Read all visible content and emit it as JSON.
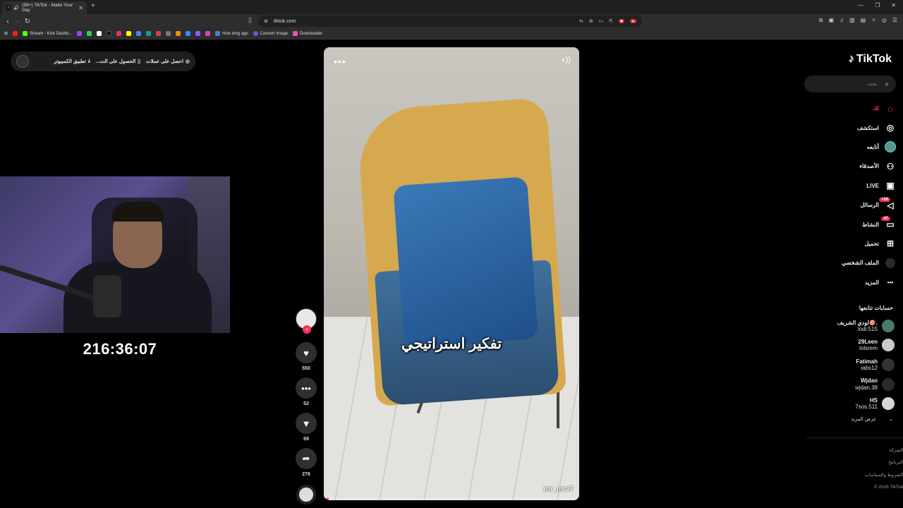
{
  "browser": {
    "tab_title": "(99+) TikTok - Make Your Day",
    "url": "tiktok.com",
    "bookmarks": [
      "Stream - Kick Dashb...",
      "How long ago",
      "Convert Image",
      "Downloader"
    ]
  },
  "top_bar": {
    "coins_label": "احصل على عملات",
    "get_app_label": "الحصول على الت...",
    "desktop_app_label": "تطبيق الكمبيوتر"
  },
  "stream": {
    "timer": "216:36:07"
  },
  "video": {
    "caption": "تفكير استراتيجي",
    "username": "mr_mrv7",
    "progress": 0.02
  },
  "actions": {
    "likes": "550",
    "comments": "52",
    "bookmarks": "69",
    "shares": "276"
  },
  "sidebar": {
    "logo": "TikTok",
    "search_placeholder": "بحث",
    "nav": [
      {
        "label": "لك",
        "icon": "home-icon",
        "active": true
      },
      {
        "label": "استكشف",
        "icon": "compass-icon"
      },
      {
        "label": "أتابعه",
        "icon": "following-avatar"
      },
      {
        "label": "الأصدقاء",
        "icon": "friends-icon"
      },
      {
        "label": "LIVE",
        "icon": "live-icon"
      },
      {
        "label": "الرسائل",
        "icon": "messages-icon",
        "badge": "+99"
      },
      {
        "label": "النشاط",
        "icon": "activity-icon",
        "badge": "47"
      },
      {
        "label": "تحميل",
        "icon": "upload-icon"
      },
      {
        "label": "الملف الشخصي",
        "icon": "profile-avatar"
      },
      {
        "label": "المزيد",
        "icon": "more-icon"
      }
    ],
    "following_title": "حسابات تتابعها",
    "following": [
      {
        "name": "لودي الشريف🎯.",
        "handle": "lodi.515",
        "color": "#4a7a6a"
      },
      {
        "name": "29Leen",
        "handle": "lolsrem",
        "color": "#c9c9c9"
      },
      {
        "name": "Fatimah",
        "handle": "iabs12",
        "color": "#333333"
      },
      {
        "name": "Wjdan",
        "handle": "wjdan.38",
        "color": "#2a2a2a"
      },
      {
        "name": "HS",
        "handle": "7sos.511",
        "color": "#d6d6d6"
      }
    ],
    "show_more": "عرض المزيد",
    "footer": [
      "الشركة",
      "البرنامج",
      "الشروط والسياسات",
      "© 2026 TikTok"
    ]
  },
  "colors": {
    "accent": "#fe2c55",
    "cyan": "#25f4ee",
    "page_bg": "#000000"
  }
}
